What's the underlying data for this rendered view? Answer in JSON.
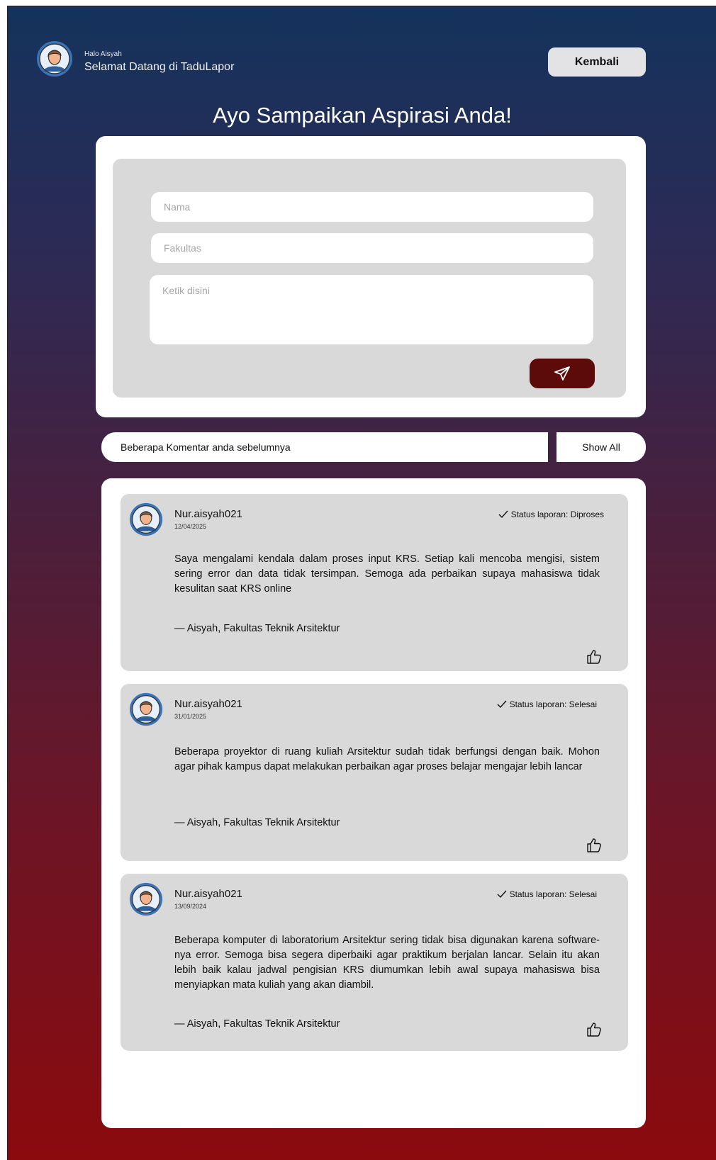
{
  "header": {
    "greeting_small": "Halo Aisyah",
    "greeting_big": "Selamat Datang di TaduLapor",
    "back_label": "Kembali"
  },
  "page_title": "Ayo Sampaikan Aspirasi Anda!",
  "form": {
    "name_placeholder": "Nama",
    "faculty_placeholder": "Fakultas",
    "message_placeholder": "Ketik disini",
    "send_icon": "send-paper-plane-icon"
  },
  "comments_section": {
    "label": "Beberapa Komentar anda sebelumnya",
    "show_all_label": "Show All"
  },
  "comments": [
    {
      "user": "Nur.aisyah021",
      "date": "12/04/2025",
      "status": "Status laporan: Diproses",
      "text": "Saya mengalami kendala dalam proses input KRS. Setiap kali mencoba mengisi, sistem sering error dan data tidak tersimpan. Semoga ada perbaikan supaya mahasiswa tidak kesulitan saat KRS online",
      "signature": "— Aisyah, Fakultas Teknik Arsitektur"
    },
    {
      "user": "Nur.aisyah021",
      "date": "31/01/2025",
      "status": "Status laporan: Selesai",
      "text": "Beberapa proyektor di ruang kuliah Arsitektur sudah tidak berfungsi dengan baik. Mohon agar pihak kampus dapat melakukan perbaikan agar proses belajar mengajar lebih lancar",
      "signature": "— Aisyah, Fakultas Teknik Arsitektur"
    },
    {
      "user": "Nur.aisyah021",
      "date": "13/09/2024",
      "status": "Status laporan: Selesai",
      "text": "Beberapa komputer di laboratorium Arsitektur sering tidak bisa digunakan karena software-nya error. Semoga bisa segera diperbaiki agar praktikum berjalan lancar. Selain itu akan lebih baik kalau jadwal pengisian KRS diumumkan lebih awal supaya mahasiswa bisa menyiapkan mata kuliah yang akan diambil.",
      "signature": "— Aisyah, Fakultas Teknik Arsitektur"
    }
  ],
  "colors": {
    "send_button": "#5c0a0a",
    "gradient_top": "#14335c",
    "gradient_bottom": "#8b0a0e",
    "card_gray": "#d9d9d9"
  }
}
